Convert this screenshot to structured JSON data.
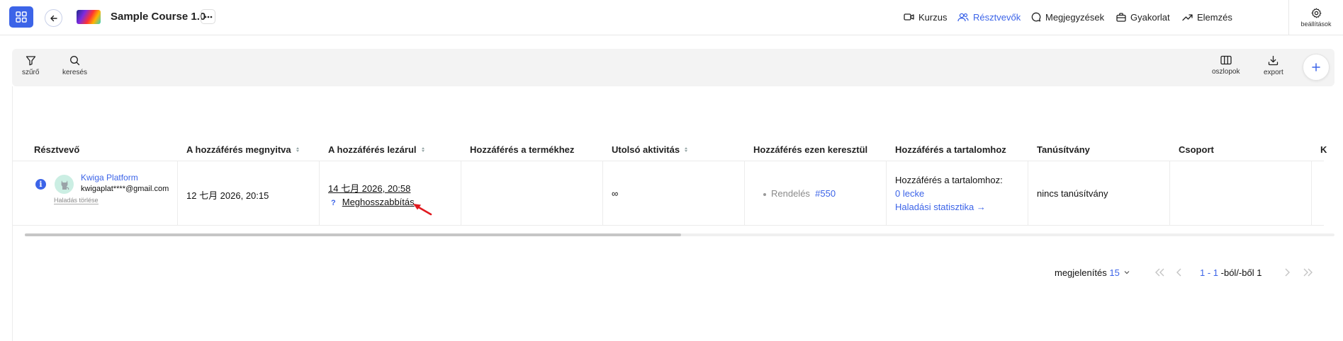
{
  "header": {
    "course_title": "Sample Course 1.0",
    "nav": [
      {
        "label": "Kurzus",
        "icon": "video-icon",
        "active": false
      },
      {
        "label": "Résztvevők",
        "icon": "users-icon",
        "active": true
      },
      {
        "label": "Megjegyzések",
        "icon": "comment-icon",
        "active": false
      },
      {
        "label": "Gyakorlat",
        "icon": "briefcase-icon",
        "active": false
      },
      {
        "label": "Elemzés",
        "icon": "trend-icon",
        "active": false
      }
    ],
    "settings_label": "beállítások"
  },
  "toolbar": {
    "filter_label": "szűrő",
    "search_label": "keresés",
    "columns_label": "oszlopok",
    "export_label": "export"
  },
  "table": {
    "columns": [
      "Résztvevő",
      "A hozzáférés megnyitva",
      "A hozzáférés lezárul",
      "Hozzáférés a termékhez",
      "Utolsó aktivitás",
      "Hozzáférés ezen keresztül",
      "Hozzáférés a tartalomhoz",
      "Tanúsítvány",
      "Csoport",
      "K"
    ],
    "row": {
      "user_name": "Kwiga Platform",
      "user_email": "kwigaplat****@gmail.com",
      "reset_progress": "Haladás törlése",
      "opened": "12 七月 2026, 20:15",
      "closes": "14 七月 2026, 20:58",
      "extend_q": "?",
      "extend_label": "Meghosszabbítás",
      "last_activity": "∞",
      "via_prefix": "Rendelés",
      "via_order": "#550",
      "content_heading": "Hozzáférés a tartalomhoz:",
      "content_lessons": "0 lecke",
      "content_stats": "Haladási statisztika →",
      "certificate": "nincs tanúsítvány"
    }
  },
  "pagination": {
    "show_label": "megjelenítés",
    "page_size": "15",
    "range": "1 - 1",
    "of_label": "-ból/-ből 1"
  },
  "colors": {
    "accent": "#3c64e8",
    "annotation_arrow": "#e0191f"
  }
}
